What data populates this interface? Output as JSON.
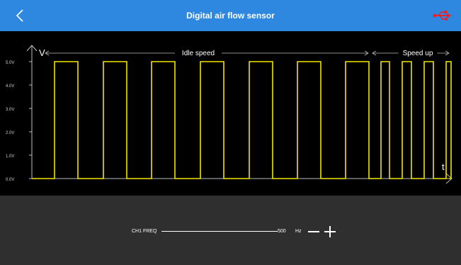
{
  "header": {
    "title": "Digital air flow sensor",
    "back_icon": "chevron-left-icon",
    "usb_icon": "usb-icon",
    "bar_color": "#2f88df",
    "usb_color": "#e8232a"
  },
  "scope": {
    "y_axis_label": "V",
    "x_axis_label": "t",
    "y_ticks": [
      "5.0V",
      "4.0V",
      "3.0V",
      "2.0V",
      "1.0V",
      "0.0V"
    ],
    "region_labels": [
      "Idle speed",
      "Speed up"
    ],
    "trace_color": "#f2e400",
    "axis_color": "#bdbdbd"
  },
  "chart_data": {
    "type": "line",
    "title": "",
    "xlabel": "t",
    "ylabel": "V",
    "ylim": [
      0,
      5
    ],
    "y_ticks": [
      0,
      1,
      2,
      3,
      4,
      5
    ],
    "grid": false,
    "annotations": [
      "Idle speed",
      "Speed up"
    ],
    "series": [
      {
        "pulses": [
          {
            "section": "Idle speed",
            "count": 7
          },
          {
            "section": "Speed up",
            "count": 4
          }
        ],
        "high": 5.0,
        "low": 0.0
      }
    ]
  },
  "controls": {
    "channel_label": "CH1 FREQ",
    "frequency_value": "500",
    "unit": "Hz",
    "minus_icon": "minus-icon",
    "plus_icon": "plus-icon"
  }
}
